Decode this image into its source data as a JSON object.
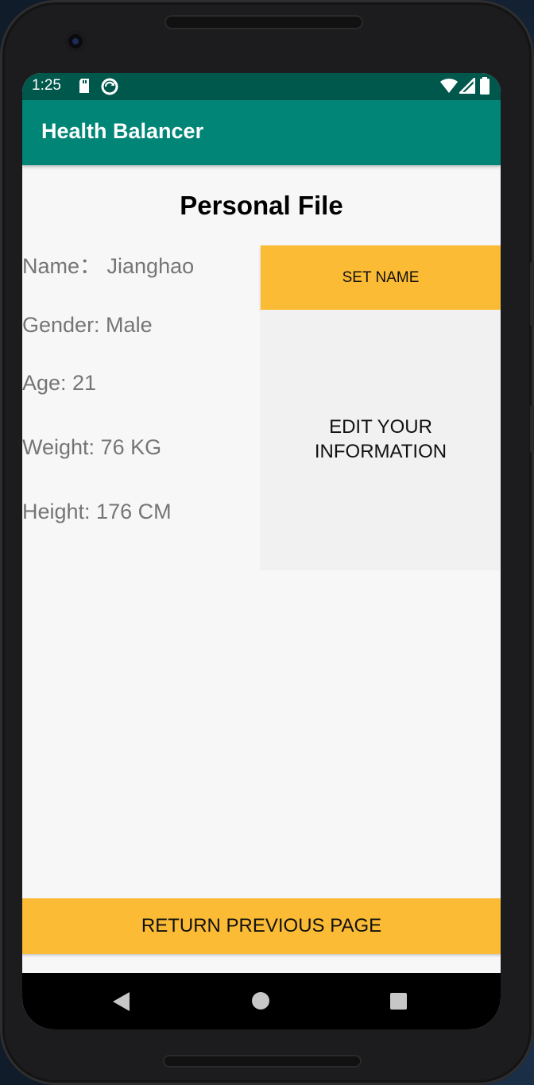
{
  "status_bar": {
    "time": "1:25",
    "icons": [
      "sd-card-icon",
      "sync-icon",
      "wifi-icon",
      "signal-icon",
      "battery-icon"
    ]
  },
  "app_bar": {
    "title": "Health Balancer"
  },
  "page": {
    "title": "Personal File",
    "info": {
      "name": "Name： Jianghao",
      "gender": "Gender: Male",
      "age": "Age: 21",
      "weight": "Weight: 76 KG",
      "height": "Height: 176 CM"
    },
    "buttons": {
      "set_name": "SET NAME",
      "edit_line1": "EDIT YOUR",
      "edit_line2": "INFORMATION",
      "return": "RETURN PREVIOUS PAGE"
    }
  },
  "nav_bar": {
    "icons": [
      "back-icon",
      "home-icon",
      "recents-icon"
    ]
  },
  "colors": {
    "status_bar": "#00574b",
    "app_bar": "#008577",
    "accent_button": "#fbbb35",
    "background": "#f7f7f7",
    "info_text": "#757575"
  }
}
